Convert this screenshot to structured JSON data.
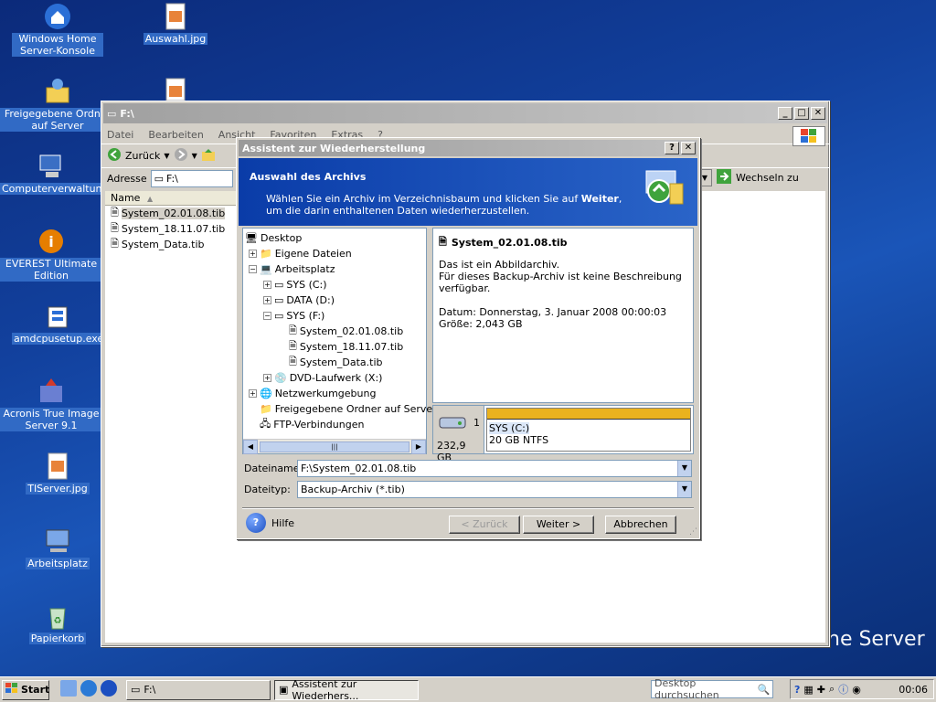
{
  "desktop": {
    "icons": [
      {
        "label": "Windows Home Server-Konsole",
        "icon": "home-server-icon"
      },
      {
        "label": "Auswahl.jpg",
        "icon": "jpg-file-icon"
      },
      {
        "label": "Freigegebene Ordner auf Server",
        "icon": "shared-folder-icon"
      },
      {
        "label": "Computerverwaltung",
        "icon": "computer-management-icon"
      },
      {
        "label": "EVEREST Ultimate Edition",
        "icon": "everest-icon"
      },
      {
        "label": "amdcpusetup.exe",
        "icon": "setup-exe-icon"
      },
      {
        "label": "Acronis True Image Server 9.1",
        "icon": "acronis-icon"
      },
      {
        "label": "TIServer.jpg",
        "icon": "jpg-file-icon"
      },
      {
        "label": "Arbeitsplatz",
        "icon": "my-computer-icon"
      },
      {
        "label": "Papierkorb",
        "icon": "recycle-bin-icon"
      }
    ],
    "brand_text": "ne Server"
  },
  "explorer": {
    "title": "F:\\",
    "menu": [
      "Datei",
      "Bearbeiten",
      "Ansicht",
      "Favoriten",
      "Extras",
      "?"
    ],
    "back_label": "Zurück",
    "address_label": "Adresse",
    "address_value": "F:\\",
    "go_label": "Wechseln zu",
    "column_name": "Name",
    "files": [
      "System_02.01.08.tib",
      "System_18.11.07.tib",
      "System_Data.tib"
    ]
  },
  "wizard": {
    "title": "Assistent zur Wiederherstellung",
    "header_title": "Auswahl des Archivs",
    "header_desc_1": "Wählen Sie ein Archiv im Verzeichnisbaum und klicken Sie auf",
    "header_desc_bold": "Weiter",
    "header_desc_2": ", um die darin enthaltenen Daten wiederherzustellen.",
    "tree": [
      {
        "label": "Desktop"
      },
      {
        "label": "Eigene Dateien"
      },
      {
        "label": "Arbeitsplatz"
      },
      {
        "label": "SYS (C:)"
      },
      {
        "label": "DATA (D:)"
      },
      {
        "label": "SYS (F:)"
      },
      {
        "label": "System_02.01.08.tib"
      },
      {
        "label": "System_18.11.07.tib"
      },
      {
        "label": "System_Data.tib"
      },
      {
        "label": "DVD-Laufwerk (X:)"
      },
      {
        "label": "Netzwerkumgebung"
      },
      {
        "label": "Freigegebene Ordner auf Server"
      },
      {
        "label": "FTP-Verbindungen"
      }
    ],
    "info": {
      "name": "System_02.01.08.tib",
      "line1": "Das ist ein Abbildarchiv.",
      "line2": "Für dieses Backup-Archiv ist keine Beschreibung verfügbar.",
      "date": "Datum: Donnerstag, 3. Januar 2008 00:00:03",
      "size": "Größe: 2,043 GB"
    },
    "disk": {
      "number": "1",
      "capacity": "232,9 GB",
      "partition_name": "SYS (C:)",
      "partition_info": "20 GB  NTFS",
      "color": "#eab21e"
    },
    "filename_label": "Dateiname:",
    "filename_value": "F:\\System_02.01.08.tib",
    "filetype_label": "Dateityp:",
    "filetype_value": "Backup-Archiv (*.tib)",
    "help_label": "Hilfe",
    "back_button": "< Zurück",
    "next_button": "Weiter >",
    "cancel_button": "Abbrechen"
  },
  "taskbar": {
    "start_label": "Start",
    "tasks": [
      "F:\\",
      "Assistent zur Wiederhers..."
    ],
    "search_placeholder": "Desktop durchsuchen",
    "clock": "00:06"
  }
}
